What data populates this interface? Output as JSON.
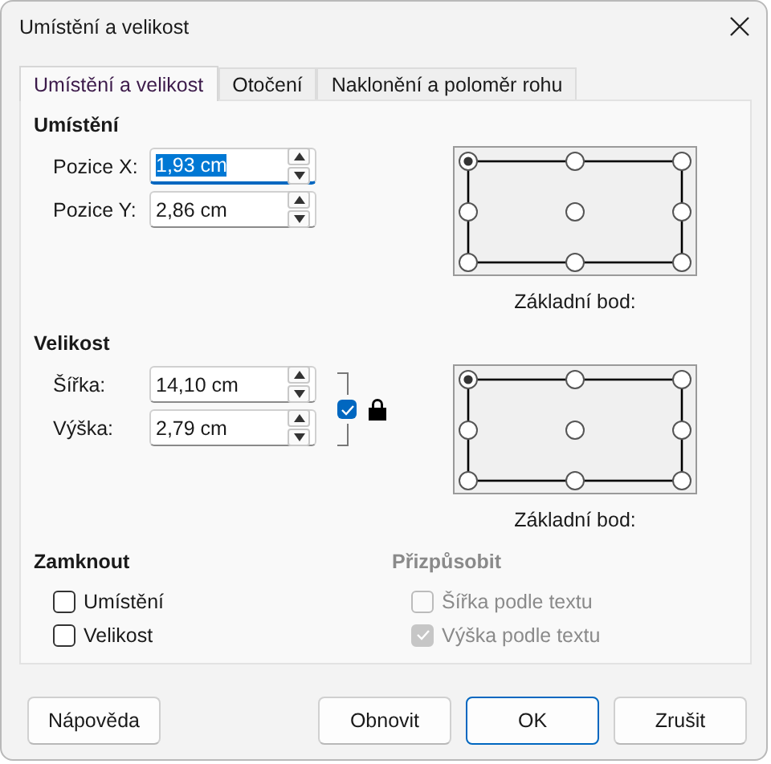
{
  "window": {
    "title": "Umístění a velikost"
  },
  "tabs": [
    {
      "label": "Umístění a velikost",
      "selected": true
    },
    {
      "label": "Otočení",
      "selected": false
    },
    {
      "label": "Naklonění a poloměr rohu",
      "selected": false
    }
  ],
  "position": {
    "heading": "Umístění",
    "fields": [
      {
        "label": "Pozice X:",
        "value": "1,93 cm",
        "focused": true
      },
      {
        "label": "Pozice Y:",
        "value": "2,86 cm",
        "focused": false
      }
    ],
    "base_point": {
      "label": "Základní bod:",
      "points": [
        {
          "selected": true
        },
        {
          "selected": false
        },
        {
          "selected": false
        },
        {
          "selected": false
        },
        {
          "selected": false
        },
        {
          "selected": false
        },
        {
          "selected": false
        },
        {
          "selected": false
        },
        {
          "selected": false
        }
      ]
    }
  },
  "size": {
    "heading": "Velikost",
    "fields": [
      {
        "label": "Šířka:",
        "value": "14,10 cm",
        "focused": false
      },
      {
        "label": "Výška:",
        "value": "2,79 cm",
        "focused": false
      }
    ],
    "keep_ratio": {
      "checked": true
    },
    "base_point": {
      "label": "Základní bod:",
      "points": [
        {
          "selected": true
        },
        {
          "selected": false
        },
        {
          "selected": false
        },
        {
          "selected": false
        },
        {
          "selected": false
        },
        {
          "selected": false
        },
        {
          "selected": false
        },
        {
          "selected": false
        },
        {
          "selected": false
        }
      ]
    }
  },
  "protect": {
    "heading": "Zamknout",
    "disabled": false,
    "items": [
      {
        "label": "Umístění",
        "checked": false,
        "disabled": false
      },
      {
        "label": "Velikost",
        "checked": false,
        "disabled": false
      }
    ]
  },
  "fit": {
    "heading": "Přizpůsobit",
    "disabled": true,
    "items": [
      {
        "label": "Šířka podle textu",
        "checked": false,
        "disabled": true
      },
      {
        "label": "Výška podle textu",
        "checked": true,
        "disabled": true
      }
    ]
  },
  "buttons": [
    {
      "label": "Nápověda",
      "kind": "help"
    },
    {
      "label": "Obnovit",
      "kind": "plain"
    },
    {
      "label": "OK",
      "kind": "default"
    },
    {
      "label": "Zrušit",
      "kind": "plain"
    }
  ]
}
